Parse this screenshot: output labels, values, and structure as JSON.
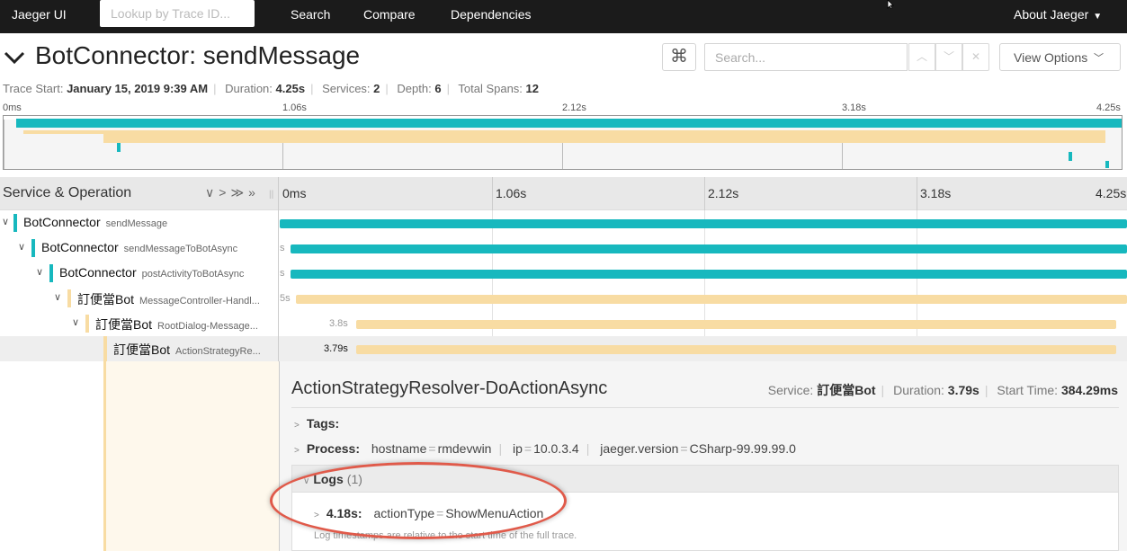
{
  "topnav": {
    "brand": "Jaeger UI",
    "lookup_placeholder": "Lookup by Trace ID...",
    "links": [
      "Search",
      "Compare",
      "Dependencies"
    ],
    "about": "About Jaeger"
  },
  "header": {
    "title": "BotConnector: sendMessage",
    "search_placeholder": "Search...",
    "view_options": "View Options"
  },
  "meta": {
    "trace_start_label": "Trace Start:",
    "trace_start": "January 15, 2019 9:39 AM",
    "duration_label": "Duration:",
    "duration": "4.25s",
    "services_label": "Services:",
    "services": "2",
    "depth_label": "Depth:",
    "depth": "6",
    "total_spans_label": "Total Spans:",
    "total_spans": "12"
  },
  "minimap_ticks": [
    "0ms",
    "1.06s",
    "2.12s",
    "3.18s",
    "4.25s"
  ],
  "timeline": {
    "column_title": "Service & Operation",
    "ticks": [
      "0ms",
      "1.06s",
      "2.12s",
      "3.18s",
      "4.25s"
    ]
  },
  "colors": {
    "botconnector": "#17b8be",
    "bot": "#f8dca3"
  },
  "spans": [
    {
      "service": "BotConnector",
      "operation": "sendMessage",
      "duration": "",
      "color_key": "botconnector",
      "start_frac": 0.0,
      "width_frac": 1.0
    },
    {
      "service": "BotConnector",
      "operation": "sendMessageToBotAsync",
      "duration": "s",
      "color_key": "botconnector",
      "start_frac": 0.012,
      "width_frac": 0.988
    },
    {
      "service": "BotConnector",
      "operation": "postActivityToBotAsync",
      "duration": "s",
      "color_key": "botconnector",
      "start_frac": 0.012,
      "width_frac": 0.988
    },
    {
      "service": "訂便當Bot",
      "operation": "MessageController-Handl...",
      "duration": "5s",
      "color_key": "bot",
      "start_frac": 0.018,
      "width_frac": 0.982
    },
    {
      "service": "訂便當Bot",
      "operation": "RootDialog-Message...",
      "duration": "3.8s",
      "color_key": "bot",
      "start_frac": 0.09,
      "width_frac": 0.894
    },
    {
      "service": "訂便當Bot",
      "operation": "ActionStrategyRe...",
      "duration": "3.79s",
      "color_key": "bot",
      "start_frac": 0.09,
      "width_frac": 0.893
    }
  ],
  "detail": {
    "operation": "ActionStrategyResolver-DoActionAsync",
    "service_label": "Service:",
    "service": "訂便當Bot",
    "duration_label": "Duration:",
    "duration": "3.79s",
    "start_label": "Start Time:",
    "start_time": "384.29ms",
    "tags_label": "Tags:",
    "process_label": "Process:",
    "process": {
      "hostname_key": "hostname",
      "hostname_val": "rmdevwin",
      "ip_key": "ip",
      "ip_val": "10.0.3.4",
      "version_key": "jaeger.version",
      "version_val": "CSharp-99.99.99.0"
    },
    "logs_label": "Logs",
    "logs_count": "(1)",
    "log_time": "4.18s:",
    "log_key": "actionType",
    "log_val": "ShowMenuAction",
    "footnote": "Log timestamps are relative to the start time of the full trace."
  }
}
